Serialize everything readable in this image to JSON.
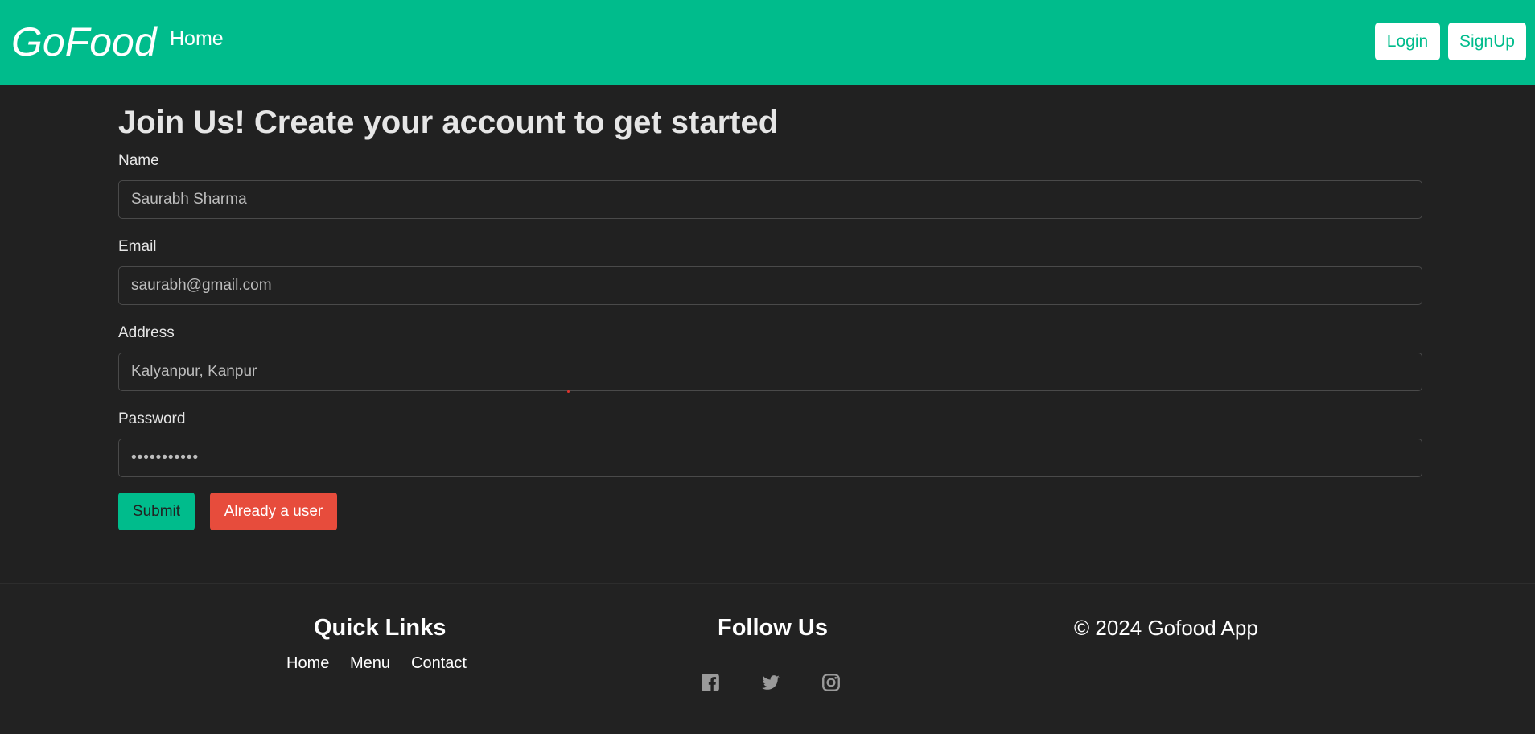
{
  "navbar": {
    "brand": "GoFood",
    "home_label": "Home",
    "login_label": "Login",
    "signup_label": "SignUp",
    "background_color": "#00bc8c"
  },
  "form": {
    "title": "Join Us! Create your account to get started",
    "fields": [
      {
        "label": "Name",
        "value": "Saurabh Sharma"
      },
      {
        "label": "Email",
        "value": "saurabh@gmail.com"
      },
      {
        "label": "Address",
        "value": "Kalyanpur, Kanpur"
      },
      {
        "label": "Password",
        "value": "•••••••••••"
      }
    ],
    "submit_label": "Submit",
    "already_user_label": "Already a user",
    "submit_color": "#00bc8c",
    "already_user_color": "#e74c3c"
  },
  "footer": {
    "quick_links_title": "Quick Links",
    "links": [
      "Home",
      "Menu",
      "Contact"
    ],
    "follow_us_title": "Follow Us",
    "social_icons": [
      "facebook-icon",
      "twitter-icon",
      "instagram-icon"
    ],
    "copyright": "© 2024 Gofood App"
  }
}
